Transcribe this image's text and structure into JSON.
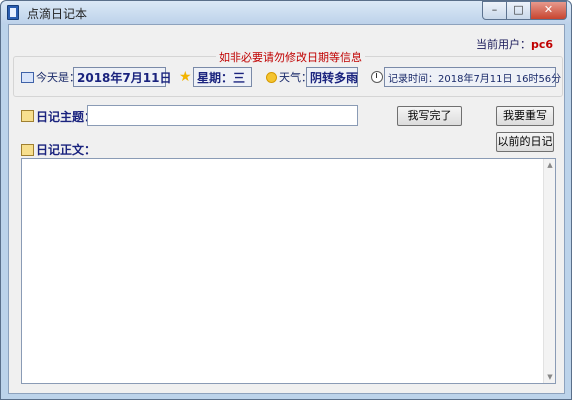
{
  "window": {
    "title": "点滴日记本",
    "min_glyph": "–",
    "max_glyph": "□",
    "close_glyph": "✕"
  },
  "current_user": {
    "label": "当前用户：",
    "name": "pc6"
  },
  "info_group": {
    "legend": "如非必要请勿修改日期等信息"
  },
  "today": {
    "label": "今天是：",
    "value": "2018年7月11日"
  },
  "weekday": {
    "label": "星期：",
    "value": "三"
  },
  "weather": {
    "label": "天气：",
    "value": "阴转多雨"
  },
  "record_time": {
    "label": "记录时间：",
    "value": "2018年7月11日  16时56分"
  },
  "subject": {
    "label": "日记主题：",
    "value": ""
  },
  "buttons": {
    "done": "我写完了",
    "rewrite": "我要重写",
    "previous": "以前的日记"
  },
  "body": {
    "label": "日记正文：",
    "value": ""
  },
  "colors": {
    "window_frame": "#bcd3ea",
    "client_bg": "#f0f0f0",
    "warning_text": "#c00000",
    "label_text": "#1a237e"
  },
  "icons": [
    "app-icon",
    "calendar-icon",
    "star-icon",
    "sun-icon",
    "clock-icon",
    "note-icon"
  ]
}
